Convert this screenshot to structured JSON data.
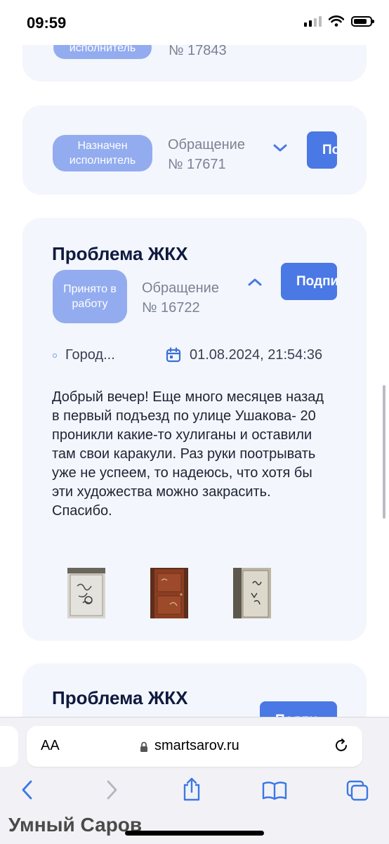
{
  "status": {
    "time": "09:59"
  },
  "cards": [
    {
      "badge": "исполнитель",
      "appeal_number": "№ 17843"
    },
    {
      "badge": "Назначен исполнитель",
      "appeal_label": "Обращение",
      "appeal_number": "№ 17671",
      "button": "По"
    },
    {
      "title": "Проблема ЖКХ",
      "badge": "Принято в работу",
      "appeal_label": "Обращение",
      "appeal_number": "№ 16722",
      "button": "Подпи",
      "location": "Город...",
      "date": "01.08.2024, 21:54:36",
      "description": "Добрый вечер! Еще много месяцев назад в первый подъезд по улице Ушакова- 20 проникли какие-то хулиганы и оставили там свои каракули. Раз руки поотрывать уже не успеем, то надеюсь, что хотя бы эти художества можно закрасить. Спасибо."
    },
    {
      "title": "Проблема ЖКХ",
      "button": "Подпи"
    }
  ],
  "browser": {
    "aa_label": "AA",
    "url": "smartsarov.ru"
  },
  "app_name": "Умный Саров",
  "colors": {
    "accent": "#4a78e4",
    "badge": "#93acef",
    "card_bg": "#f3f6fc"
  }
}
